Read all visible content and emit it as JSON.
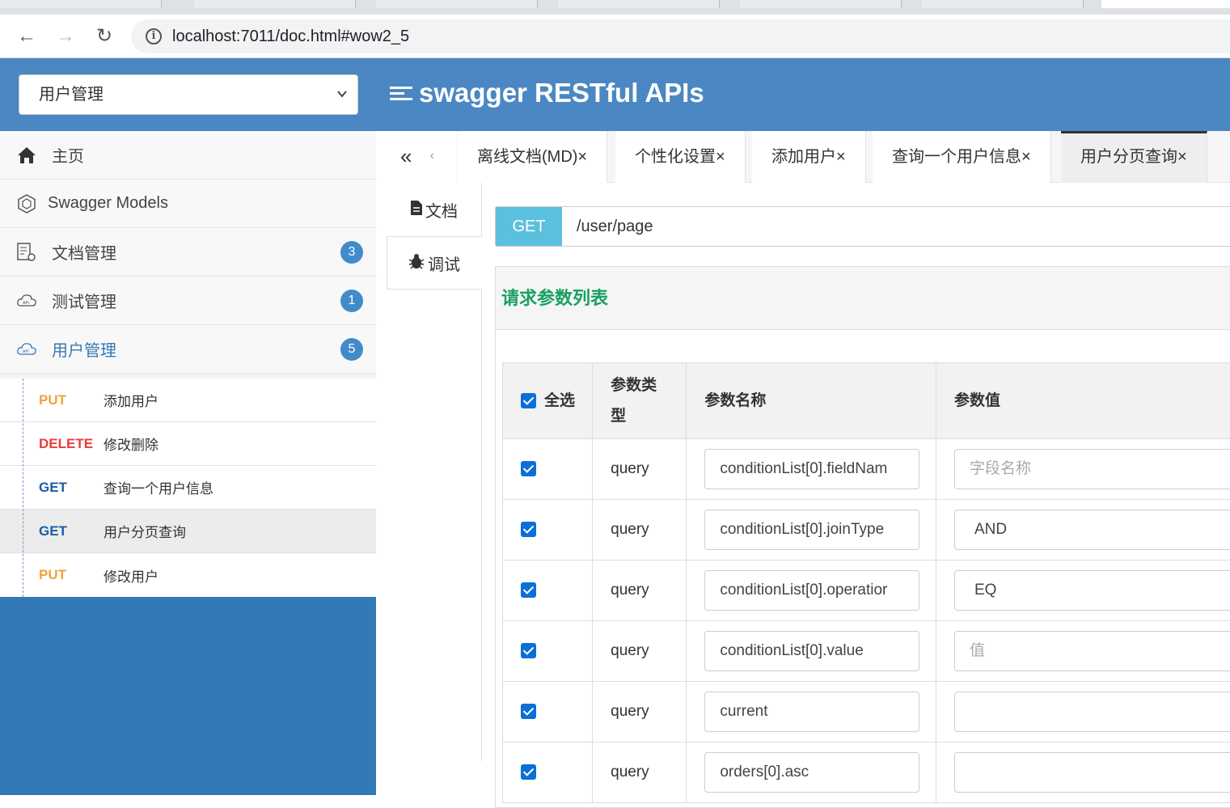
{
  "browser": {
    "url": "localhost:7011/doc.html#wow2_5"
  },
  "header": {
    "group_select": "用户管理",
    "brand_title": "swagger RESTful APIs"
  },
  "sidebar": {
    "items": [
      {
        "label": "主页",
        "icon": "home-icon"
      },
      {
        "label": "Swagger Models",
        "icon": "cube-icon"
      },
      {
        "label": "文档管理",
        "icon": "doc-settings-icon",
        "badge": "3"
      },
      {
        "label": "测试管理",
        "icon": "cloud-api-icon",
        "badge": "1"
      },
      {
        "label": "用户管理",
        "icon": "cloud-api-icon",
        "badge": "5"
      }
    ],
    "sub_items": [
      {
        "method": "PUT",
        "label": "添加用户"
      },
      {
        "method": "DELETE",
        "label": "修改删除"
      },
      {
        "method": "GET",
        "label": "查询一个用户信息"
      },
      {
        "method": "GET",
        "label": "用户分页查询"
      },
      {
        "method": "PUT",
        "label": "修改用户"
      }
    ]
  },
  "tabs": {
    "prev_label": "«",
    "items": [
      "离线文档(MD)×",
      "个性化设置×",
      "添加用户×",
      "查询一个用户信息×",
      "用户分页查询×"
    ]
  },
  "vtabs": {
    "doc_label": "文档",
    "debug_label": "调试"
  },
  "request": {
    "method": "GET",
    "path": "/user/page"
  },
  "params": {
    "title": "请求参数列表",
    "headers": {
      "select_all": "全选",
      "type_line1": "参数类",
      "type_line2": "型",
      "name": "参数名称",
      "value": "参数值"
    },
    "rows": [
      {
        "checked": true,
        "type": "query",
        "name": "conditionList[0].fieldNam",
        "value": "",
        "placeholder": "字段名称"
      },
      {
        "checked": true,
        "type": "query",
        "name": "conditionList[0].joinType",
        "value": "AND",
        "placeholder": ""
      },
      {
        "checked": true,
        "type": "query",
        "name": "conditionList[0].operatior",
        "value": "EQ",
        "placeholder": ""
      },
      {
        "checked": true,
        "type": "query",
        "name": "conditionList[0].value",
        "value": "",
        "placeholder": "值"
      },
      {
        "checked": true,
        "type": "query",
        "name": "current",
        "value": "",
        "placeholder": ""
      },
      {
        "checked": true,
        "type": "query",
        "name": "orders[0].asc",
        "value": "",
        "placeholder": ""
      }
    ]
  },
  "colors": {
    "header_bg": "#4b87c3",
    "sidebar_bg": "#3379b5",
    "get_badge": "#5bc0de",
    "put": "#f0a33a",
    "delete": "#e83c3c",
    "get": "#1a5ea8",
    "title_green": "#1aa061"
  }
}
